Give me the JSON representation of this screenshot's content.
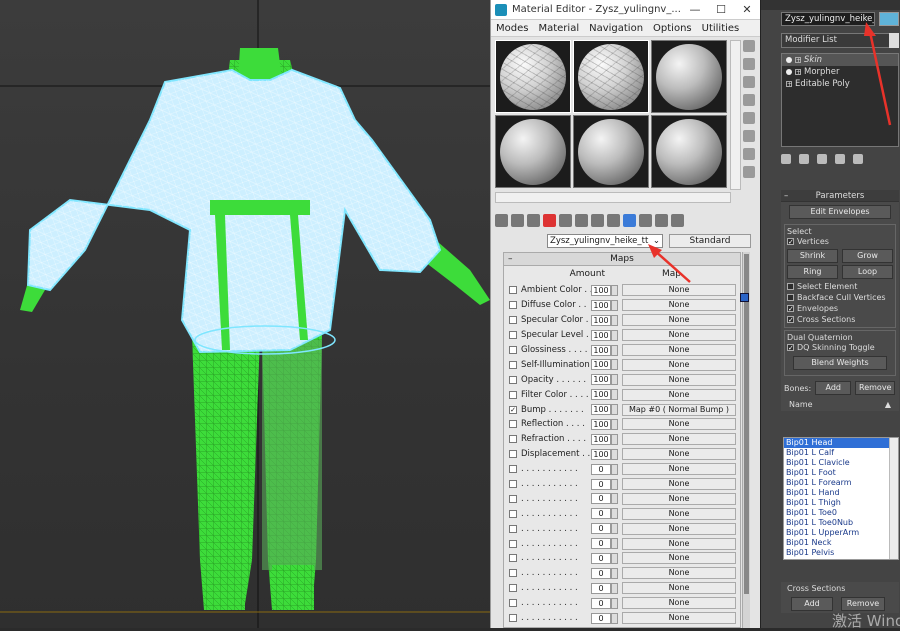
{
  "material_editor": {
    "title": "Material Editor - Zysz_yulingnv_...",
    "window_controls": {
      "minimize": "—",
      "maximize": "☐",
      "close": "✕"
    },
    "menu": [
      "Modes",
      "Material",
      "Navigation",
      "Options",
      "Utilities"
    ],
    "material_name": "Zysz_yulingnv_heike_tt",
    "material_type": "Standard",
    "maps_title": "Maps",
    "amount_header": "Amount",
    "map_header": "Map",
    "maps": [
      {
        "checked": false,
        "label": "Ambient Color . .",
        "amount": "100",
        "map": "None"
      },
      {
        "checked": false,
        "label": "Diffuse Color . .",
        "amount": "100",
        "map": "None"
      },
      {
        "checked": false,
        "label": "Specular Color . .",
        "amount": "100",
        "map": "None"
      },
      {
        "checked": false,
        "label": "Specular Level . .",
        "amount": "100",
        "map": "None"
      },
      {
        "checked": false,
        "label": "Glossiness . . . .",
        "amount": "100",
        "map": "None"
      },
      {
        "checked": false,
        "label": "Self-Illumination .",
        "amount": "100",
        "map": "None"
      },
      {
        "checked": false,
        "label": "Opacity . . . . . .",
        "amount": "100",
        "map": "None"
      },
      {
        "checked": false,
        "label": "Filter Color . . . .",
        "amount": "100",
        "map": "None"
      },
      {
        "checked": true,
        "label": "Bump . . . . . . .",
        "amount": "100",
        "map": "Map #0  ( Normal Bump )"
      },
      {
        "checked": false,
        "label": "Reflection . . . .",
        "amount": "100",
        "map": "None"
      },
      {
        "checked": false,
        "label": "Refraction . . . .",
        "amount": "100",
        "map": "None"
      },
      {
        "checked": false,
        "label": "Displacement . . .",
        "amount": "100",
        "map": "None"
      },
      {
        "checked": false,
        "label": ". . . . . . . . . . .",
        "amount": "0",
        "map": "None"
      },
      {
        "checked": false,
        "label": ". . . . . . . . . . .",
        "amount": "0",
        "map": "None"
      },
      {
        "checked": false,
        "label": ". . . . . . . . . . .",
        "amount": "0",
        "map": "None"
      },
      {
        "checked": false,
        "label": ". . . . . . . . . . .",
        "amount": "0",
        "map": "None"
      },
      {
        "checked": false,
        "label": ". . . . . . . . . . .",
        "amount": "0",
        "map": "None"
      },
      {
        "checked": false,
        "label": ". . . . . . . . . . .",
        "amount": "0",
        "map": "None"
      },
      {
        "checked": false,
        "label": ". . . . . . . . . . .",
        "amount": "0",
        "map": "None"
      },
      {
        "checked": false,
        "label": ". . . . . . . . . . .",
        "amount": "0",
        "map": "None"
      },
      {
        "checked": false,
        "label": ". . . . . . . . . . .",
        "amount": "0",
        "map": "None"
      },
      {
        "checked": false,
        "label": ". . . . . . . . . . .",
        "amount": "0",
        "map": "None"
      },
      {
        "checked": false,
        "label": ". . . . . . . . . . .",
        "amount": "0",
        "map": "None"
      }
    ]
  },
  "command_panel": {
    "object_name": "Zysz_yulingnv_heike_tt",
    "object_color": "#5fb3d9",
    "modifier_list_label": "Modifier List",
    "stack": [
      {
        "label": "Skin",
        "selected": true
      },
      {
        "label": "Morpher",
        "selected": false
      },
      {
        "label": "Editable Poly",
        "selected": false
      }
    ],
    "parameters_title": "Parameters",
    "edit_envelopes": "Edit Envelopes",
    "select_group": "Select",
    "vertices": "Vertices",
    "shrink": "Shrink",
    "grow": "Grow",
    "ring": "Ring",
    "loop": "Loop",
    "select_element": "Select Element",
    "backface_cull": "Backface Cull Vertices",
    "envelopes": "Envelopes",
    "cross_sections": "Cross Sections",
    "dual_quaternion": "Dual Quaternion",
    "dq_toggle": "DQ Skinning Toggle",
    "blend_weights": "Blend Weights",
    "bones_label": "Bones:",
    "add": "Add",
    "remove": "Remove",
    "name_header": "Name",
    "bones": [
      "Bip01 Head",
      "Bip01 L Calf",
      "Bip01 L Clavicle",
      "Bip01 L Foot",
      "Bip01 L Forearm",
      "Bip01 L Hand",
      "Bip01 L Thigh",
      "Bip01 L Toe0",
      "Bip01 L Toe0Nub",
      "Bip01 L UpperArm",
      "Bip01 Neck",
      "Bip01 Pelvis"
    ],
    "cross_sections_group": "Cross Sections",
    "cs_add": "Add",
    "cs_remove": "Remove"
  },
  "watermark": "激活 Wind",
  "colors": {
    "annotation_arrow": "#e8322a",
    "selection_outline": "#7fe6ff",
    "body_green": "#3ddc3a"
  }
}
